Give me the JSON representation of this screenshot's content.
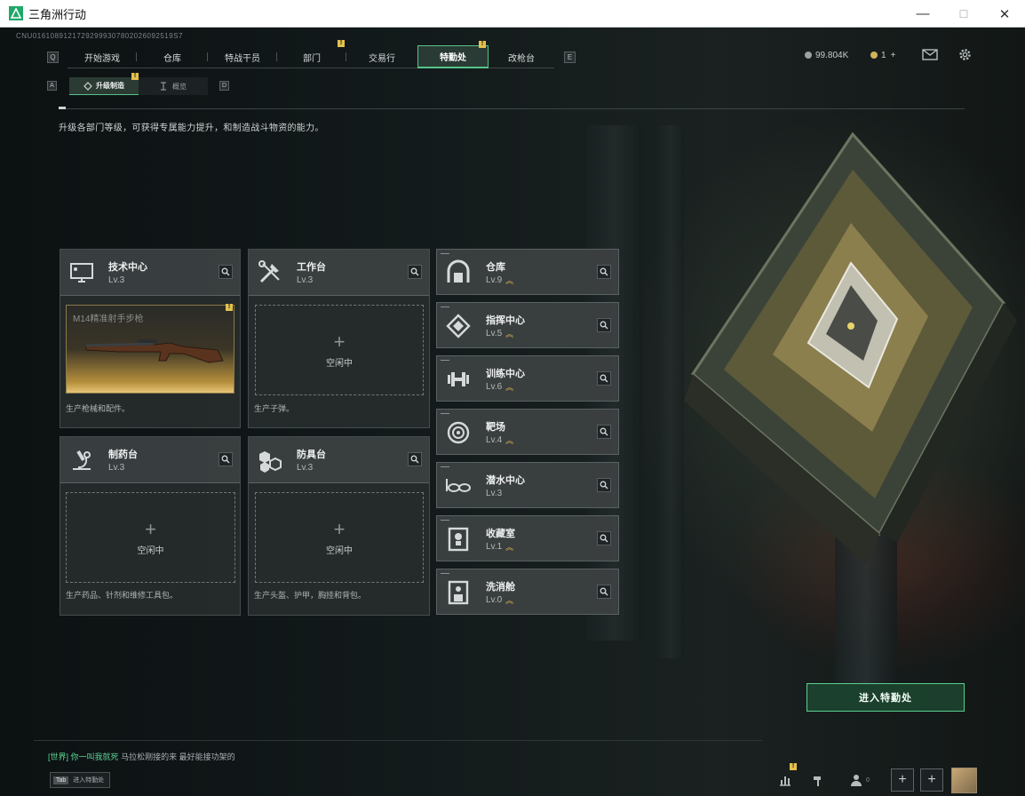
{
  "window": {
    "title": "三角洲行动",
    "minimize": "—",
    "maximize": "☐",
    "close": "✕"
  },
  "session_id": "CNU01610891217292999307802026092519S7",
  "nav": {
    "left_key": "Q",
    "right_key": "E",
    "tabs": [
      {
        "label": "开始游戏",
        "badge": ""
      },
      {
        "label": "仓库",
        "badge": ""
      },
      {
        "label": "特战干员",
        "badge": ""
      },
      {
        "label": "部门",
        "badge": "!"
      },
      {
        "label": "交易行",
        "badge": ""
      },
      {
        "label": "特勤处",
        "badge": "!",
        "active": true
      },
      {
        "label": "改枪台",
        "badge": ""
      }
    ]
  },
  "subnav": {
    "left_key": "A",
    "right_key": "D",
    "tabs": [
      {
        "label": "升级制造",
        "badge": "!"
      },
      {
        "label": "概览"
      }
    ]
  },
  "resources": {
    "coins": "99.804K",
    "tickets": "1",
    "plus": "+"
  },
  "description": "升级各部门等级，可获得专属能力提升，和制造战斗物资的能力。",
  "workshops": [
    {
      "name": "技术中心",
      "level": "Lv.3",
      "item": "M14精准射手步枪",
      "badge": "!",
      "footer": "生产枪械和配件。",
      "icon": "monitor-icon"
    },
    {
      "name": "工作台",
      "level": "Lv.3",
      "idle": "空闲中",
      "footer": "生产子弹。",
      "icon": "tools-icon"
    },
    {
      "name": "制药台",
      "level": "Lv.3",
      "idle": "空闲中",
      "footer": "生产药品、针剂和维修工具包。",
      "icon": "microscope-icon"
    },
    {
      "name": "防具台",
      "level": "Lv.3",
      "idle": "空闲中",
      "footer": "生产头盔、护甲，胸挂和背包。",
      "icon": "armor-blocks-icon"
    }
  ],
  "stations": [
    {
      "name": "仓库",
      "level": "Lv.9",
      "up": true,
      "icon": "warehouse-icon"
    },
    {
      "name": "指挥中心",
      "level": "Lv.5",
      "up": true,
      "icon": "command-chip-icon"
    },
    {
      "name": "训练中心",
      "level": "Lv.6",
      "up": true,
      "icon": "dumbbell-icon"
    },
    {
      "name": "靶场",
      "level": "Lv.4",
      "up": true,
      "icon": "target-icon"
    },
    {
      "name": "潜水中心",
      "level": "Lv.3",
      "up": false,
      "icon": "diving-goggles-icon"
    },
    {
      "name": "收藏室",
      "level": "Lv.1",
      "up": true,
      "icon": "trophy-case-icon"
    },
    {
      "name": "洗消舱",
      "level": "Lv.0",
      "up": true,
      "icon": "decon-icon"
    }
  ],
  "enter_button": "进入特勤处",
  "chat": {
    "channel": "[世界]",
    "user": "你一叫我就死",
    "message": "马拉松刚接的来 最好能接功架的"
  },
  "tab_hint": {
    "key": "Tab",
    "label": "进入特勤处"
  },
  "bottom": {
    "friends_count": "0",
    "badge": "!",
    "add1": "+",
    "add2": "+"
  },
  "colors": {
    "accent": "#55c48a",
    "badge": "#e3c14d",
    "upgrade": "#e0b84c"
  }
}
